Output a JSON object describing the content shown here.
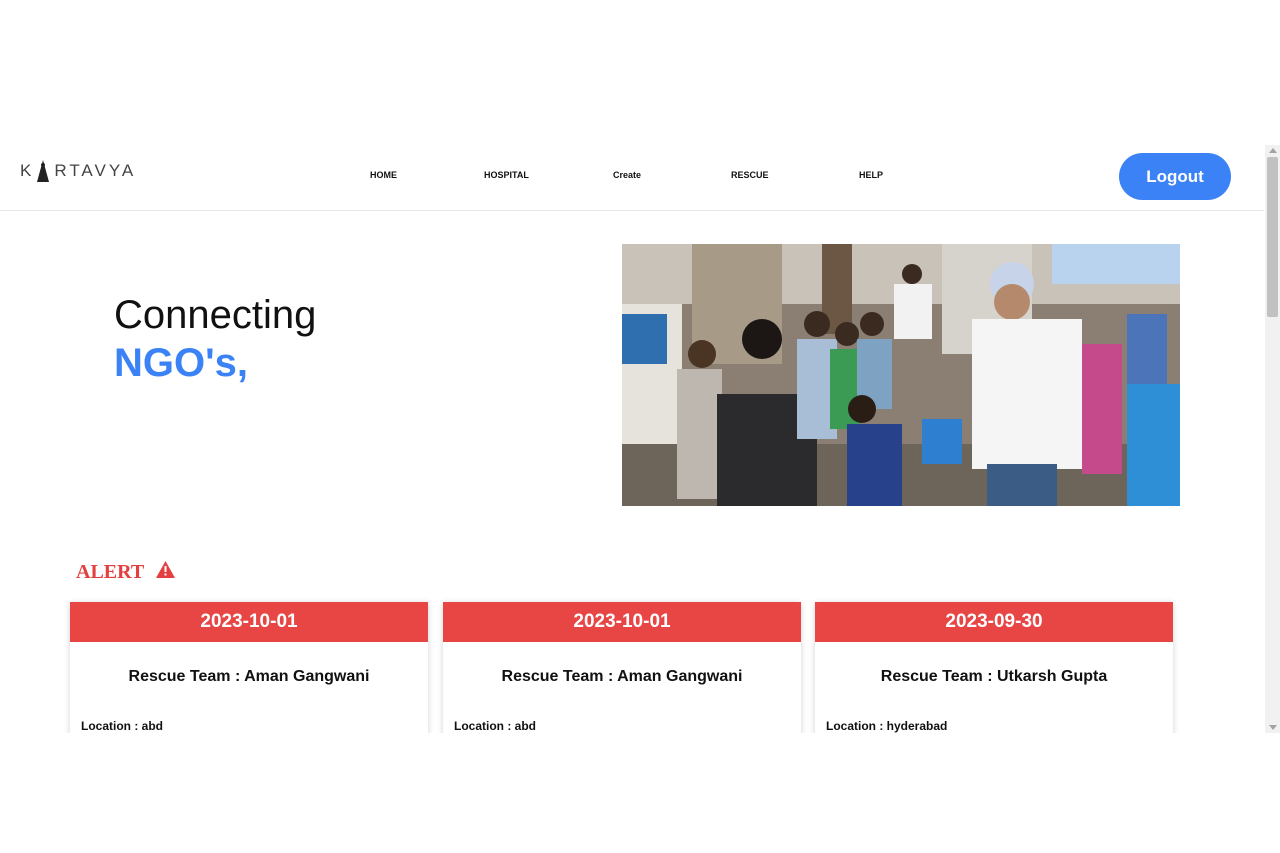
{
  "brand": {
    "name": "KARTAVYA",
    "prefix": "K",
    "suffix": "RTAVYA"
  },
  "nav": {
    "items": [
      {
        "label": "HOME"
      },
      {
        "label": "HOSPITAL"
      },
      {
        "label": "Create"
      },
      {
        "label": "RESCUE"
      },
      {
        "label": "HELP"
      }
    ],
    "logout_label": "Logout"
  },
  "hero": {
    "line1": "Connecting",
    "line2": "NGO's,"
  },
  "alert": {
    "heading": "ALERT",
    "icon": "warning-triangle-icon",
    "cards": [
      {
        "date": "2023-10-01",
        "team": "Rescue Team : Aman Gangwani",
        "location": "Location : abd"
      },
      {
        "date": "2023-10-01",
        "team": "Rescue Team : Aman Gangwani",
        "location": "Location : abd"
      },
      {
        "date": "2023-09-30",
        "team": "Rescue Team : Utkarsh Gupta",
        "location": "Location : hyderabad"
      }
    ]
  },
  "colors": {
    "accent": "#3b82f6",
    "alert": "#e53e3e",
    "card_header": "#e84545"
  }
}
